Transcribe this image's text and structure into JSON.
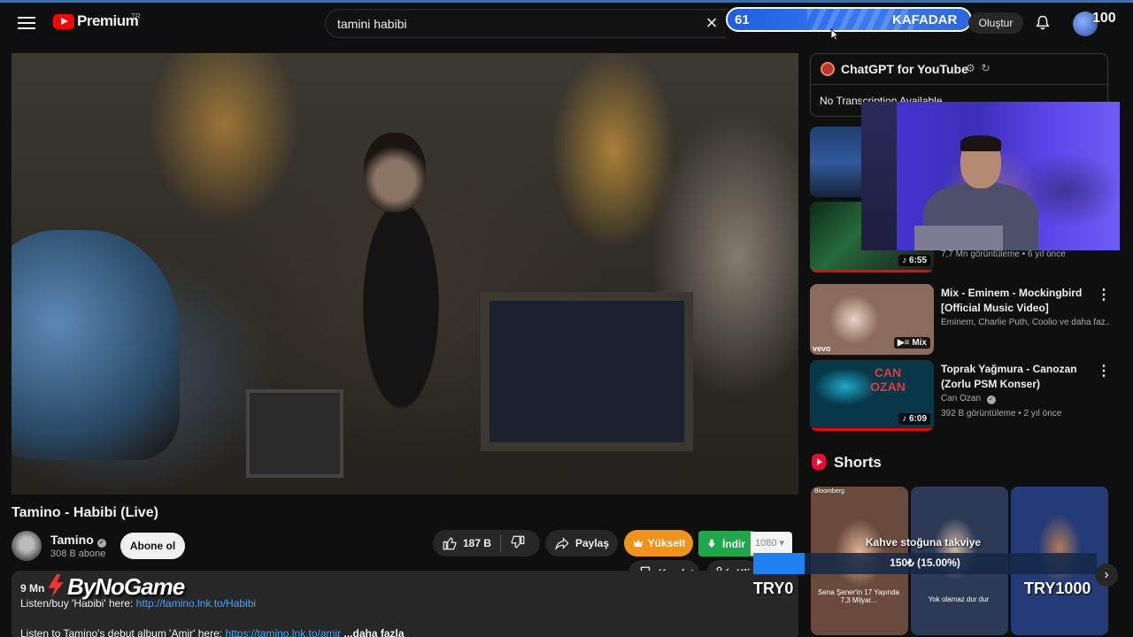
{
  "header": {
    "logo_text": "Premium",
    "logo_region": "TR",
    "search_value": "tamini habibi",
    "create_label": "Oluştur"
  },
  "overlay": {
    "counter_left": "61",
    "counter_name": "KAFADAR",
    "counter_right": "100",
    "watermark": "ByNoGame",
    "donation": {
      "title": "Kahve stoğuna takviye",
      "progress_text": "150₺ (15.00%)",
      "progress": 0.15,
      "min_label": "TRY0",
      "max_label": "TRY1000"
    }
  },
  "video": {
    "title": "Tamino - Habibi (Live)",
    "channel": "Tamino",
    "subscribers": "308 B abone",
    "subscribe_label": "Abone ol",
    "likes": "187 B",
    "share_label": "Paylaş",
    "upgrade_label": "Yükselt",
    "download_label": "İndir",
    "quality": "1080",
    "save_label": "Kaydet",
    "clip_label": "Klip"
  },
  "description": {
    "views": "9 Mn",
    "line1_prefix": "Listen/buy 'Habibi' here: ",
    "line1_link": "http://tamino.lnk.to/Habibi",
    "line2_prefix": "Listen to Tamino's debut album 'Amir' here: ",
    "line2_link": "https://tamino.lnk.to/amir",
    "more_label": "...daha fazla"
  },
  "sidebar": {
    "gpt_title": "ChatGPT for YouTube",
    "gpt_message": "No Transcription Available",
    "recommendations": [
      {
        "duration": "",
        "meta": ""
      },
      {
        "duration": "6:55",
        "meta": "7,7 Mn görüntüleme • 6 yıl önce"
      },
      {
        "title": "Mix - Eminem - Mockingbird [Official Music Video]",
        "meta": "Eminem, Charlie Puth, Coolio ve daha faz...",
        "badge": "Mix",
        "thumb_label": "vevo"
      },
      {
        "title": "Toprak Yağmura - Canozan (Zorlu PSM Konser)",
        "channel": "Can Ozan",
        "meta": "392 B görüntüleme • 2 yıl önce",
        "duration": "6:09",
        "thumb_text": "CAN OZAN"
      }
    ],
    "shorts_title": "Shorts",
    "shorts": [
      {
        "top_label": "Bloomberg",
        "caption": "Sena Şener'in 17 Yaşında 7,3 Milyar..."
      },
      {
        "top_label": "",
        "caption": "Yok olamaz dur dur"
      },
      {
        "top_label": "",
        "caption": ""
      }
    ]
  },
  "colors": {
    "background": "#0f0f0f",
    "accent_red": "#ff0000",
    "link": "#3ea6ff",
    "upgrade": "#f29318",
    "download": "#1fa84a",
    "counter_blue": "#2c66dd"
  }
}
